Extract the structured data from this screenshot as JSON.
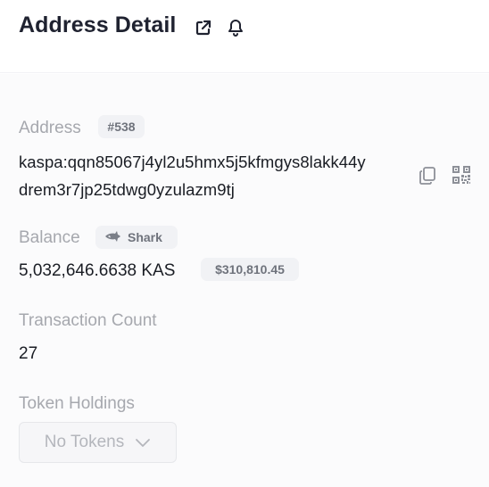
{
  "header": {
    "title": "Address Detail",
    "icons": [
      "external-link-icon",
      "bell-icon"
    ]
  },
  "address": {
    "label": "Address",
    "rank_badge": "#538",
    "line1": "kaspa:qqn85067j4yl2u5hmx5j5kfmgys8lakk44y",
    "line2": "drem3r7jp25tdwg0yzulazm9tj",
    "actions": [
      "copy-icon",
      "qr-code-icon"
    ]
  },
  "balance": {
    "label": "Balance",
    "tier_badge": "Shark",
    "tier_icon": "shark-icon",
    "amount": "5,032,646.6638 KAS",
    "usd_value": "$310,810.45"
  },
  "transactions": {
    "label": "Transaction Count",
    "count": "27"
  },
  "tokens": {
    "label": "Token Holdings",
    "dropdown_value": "No Tokens",
    "dropdown_icon": "chevron-down-icon"
  },
  "colors": {
    "text": "#1a1d24",
    "muted": "#a6a8ae",
    "badge_bg": "#f1f2f5",
    "badge_text": "#6f737c"
  }
}
